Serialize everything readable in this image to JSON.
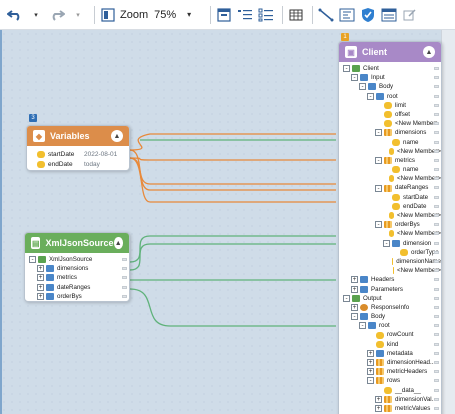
{
  "toolbar": {
    "zoom_label": "Zoom",
    "zoom_value": "75%"
  },
  "variables_node": {
    "title": "Variables",
    "rows": [
      {
        "key": "startDate",
        "value": "2022-08-01"
      },
      {
        "key": "endDate",
        "value": "today"
      }
    ]
  },
  "xml_node": {
    "title": "XmlJsonSource",
    "rows": [
      {
        "label": "XmlJsonSource",
        "expander": "-",
        "icon": "chk",
        "indent": 0
      },
      {
        "label": "dimensions",
        "expander": "+",
        "icon": "obj",
        "indent": 1
      },
      {
        "label": "metrics",
        "expander": "+",
        "icon": "obj",
        "indent": 1
      },
      {
        "label": "dateRanges",
        "expander": "+",
        "icon": "obj",
        "indent": 1
      },
      {
        "label": "orderBys",
        "expander": "+",
        "icon": "obj",
        "indent": 1
      }
    ]
  },
  "client_node": {
    "title": "Client",
    "badge": "1",
    "rows": [
      {
        "label": "Client",
        "expander": "-",
        "icon": "chk",
        "indent": 0
      },
      {
        "label": "Input",
        "expander": "-",
        "icon": "obj",
        "indent": 1
      },
      {
        "label": "Body",
        "expander": "-",
        "icon": "obj",
        "indent": 2
      },
      {
        "label": "root",
        "expander": "-",
        "icon": "obj",
        "indent": 3
      },
      {
        "label": "limit",
        "expander": "",
        "icon": "fld",
        "indent": 4
      },
      {
        "label": "offset",
        "expander": "",
        "icon": "fld",
        "indent": 4
      },
      {
        "label": "<New Member>",
        "expander": "",
        "icon": "fld",
        "indent": 4
      },
      {
        "label": "dimensions",
        "expander": "-",
        "icon": "arr",
        "indent": 4
      },
      {
        "label": "name",
        "expander": "",
        "icon": "fld",
        "indent": 5
      },
      {
        "label": "<New Member>",
        "expander": "",
        "icon": "fld",
        "indent": 5
      },
      {
        "label": "metrics",
        "expander": "-",
        "icon": "arr",
        "indent": 4
      },
      {
        "label": "name",
        "expander": "",
        "icon": "fld",
        "indent": 5
      },
      {
        "label": "<New Member>",
        "expander": "",
        "icon": "fld",
        "indent": 5
      },
      {
        "label": "dateRanges",
        "expander": "-",
        "icon": "arr",
        "indent": 4
      },
      {
        "label": "startDate",
        "expander": "",
        "icon": "fld",
        "indent": 5
      },
      {
        "label": "endDate",
        "expander": "",
        "icon": "fld",
        "indent": 5
      },
      {
        "label": "<New Member>",
        "expander": "",
        "icon": "fld",
        "indent": 5
      },
      {
        "label": "orderBys",
        "expander": "-",
        "icon": "arr",
        "indent": 4
      },
      {
        "label": "<New Member>",
        "expander": "",
        "icon": "fld",
        "indent": 5
      },
      {
        "label": "dimension",
        "expander": "-",
        "icon": "obj",
        "indent": 5
      },
      {
        "label": "orderType",
        "expander": "",
        "icon": "fld",
        "indent": 6
      },
      {
        "label": "dimensionName",
        "expander": "",
        "icon": "fld",
        "indent": 6
      },
      {
        "label": "<New Member>",
        "expander": "",
        "icon": "fld",
        "indent": 6
      },
      {
        "label": "Headers",
        "expander": "+",
        "icon": "obj",
        "indent": 1
      },
      {
        "label": "Parameters",
        "expander": "+",
        "icon": "obj",
        "indent": 1
      },
      {
        "label": "Output",
        "expander": "-",
        "icon": "chk",
        "indent": 0
      },
      {
        "label": "ResponseInfo",
        "expander": "+",
        "icon": "gear",
        "indent": 1
      },
      {
        "label": "Body",
        "expander": "-",
        "icon": "obj",
        "indent": 1
      },
      {
        "label": "root",
        "expander": "-",
        "icon": "obj",
        "indent": 2
      },
      {
        "label": "rowCount",
        "expander": "",
        "icon": "fld",
        "indent": 3
      },
      {
        "label": "kind",
        "expander": "",
        "icon": "fld",
        "indent": 3
      },
      {
        "label": "metadata",
        "expander": "+",
        "icon": "obj",
        "indent": 3
      },
      {
        "label": "dimensionHead...",
        "expander": "+",
        "icon": "arr",
        "indent": 3
      },
      {
        "label": "metricHeaders",
        "expander": "+",
        "icon": "arr",
        "indent": 3
      },
      {
        "label": "rows",
        "expander": "-",
        "icon": "arr",
        "indent": 3
      },
      {
        "label": "__data__",
        "expander": "",
        "icon": "fld",
        "indent": 4
      },
      {
        "label": "dimensionVal...",
        "expander": "+",
        "icon": "arr",
        "indent": 4
      },
      {
        "label": "metricValues",
        "expander": "+",
        "icon": "arr",
        "indent": 4
      }
    ]
  },
  "step_badges": {
    "variables": "3"
  },
  "colors": {
    "client_header": "#a889c7",
    "variables_header": "#dc8d4a",
    "xml_header": "#6aae5c",
    "line_orange": "#e8893a",
    "line_green": "#5fb27a",
    "canvas_bg": "#cfdce8"
  },
  "icons": {
    "undo": "undo-icon",
    "redo": "redo-icon",
    "fit": "fit-page-icon",
    "layout": "layout-icon",
    "list": "list-icon",
    "grid": "grid-icon",
    "connector": "connector-icon",
    "mapping": "mapping-icon",
    "shield": "shield-icon",
    "table": "table-icon",
    "edit": "edit-icon"
  }
}
